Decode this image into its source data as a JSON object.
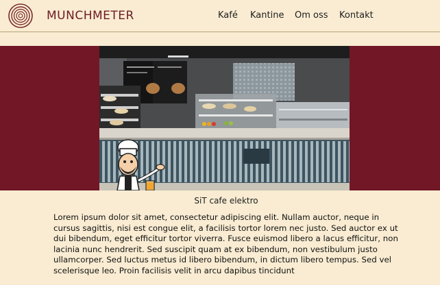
{
  "header": {
    "brand": "MUNCHMETER",
    "nav": [
      "Kafé",
      "Kantine",
      "Om oss",
      "Kontakt"
    ]
  },
  "hero": {
    "caption": "SiT cafe elektro",
    "image_icon": "cafeteria-counter-photo",
    "mascot_icon": "chef-mascot-icon"
  },
  "content": {
    "description": "Lorem ipsum dolor sit amet, consectetur adipiscing elit. Nullam auctor, neque in cursus sagittis, nisi est congue elit, a facilisis tortor lorem nec justo. Sed auctor ex ut dui bibendum, eget efficitur tortor viverra. Fusce euismod libero a lacus efficitur, non lacinia nunc hendrerit. Sed suscipit quam at ex bibendum, non vestibulum justo ullamcorper. Sed luctus metus id libero bibendum, in dictum libero tempus. Sed vel scelerisque leo. Proin facilisis velit in arcu dapibus tincidunt"
  },
  "colors": {
    "background": "#f9ecd2",
    "brand": "#6d1a24",
    "band": "#721726",
    "divider": "#b9a07a"
  }
}
